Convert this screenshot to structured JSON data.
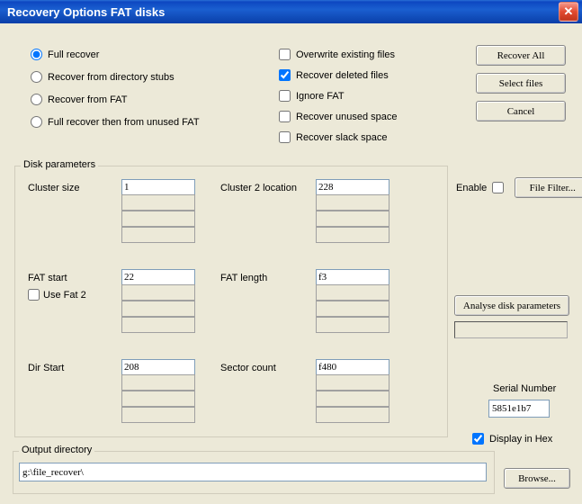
{
  "title": "Recovery Options FAT disks",
  "radios": {
    "full": "Full recover",
    "stubs": "Recover from directory stubs",
    "fat": "Recover from FAT",
    "then": "Full recover then from unused FAT"
  },
  "checks": {
    "overwrite": "Overwrite existing files",
    "deleted": "Recover deleted files",
    "ignore": "Ignore FAT",
    "unused": "Recover unused space",
    "slack": "Recover slack space"
  },
  "buttons": {
    "recover_all": "Recover All",
    "select_files": "Select files",
    "cancel": "Cancel",
    "file_filter": "File Filter...",
    "analyse": "Analyse disk parameters",
    "browse": "Browse..."
  },
  "disk_params": {
    "legend": "Disk parameters",
    "cluster_size": {
      "label": "Cluster size",
      "value": "1"
    },
    "cluster2_loc": {
      "label": "Cluster 2 location",
      "value": "228"
    },
    "fat_start": {
      "label": "FAT start",
      "value": "22"
    },
    "fat_length": {
      "label": "FAT length",
      "value": "f3"
    },
    "use_fat2": "Use Fat 2",
    "dir_start": {
      "label": "Dir Start",
      "value": "208"
    },
    "sector_count": {
      "label": "Sector count",
      "value": "f480"
    }
  },
  "enable_label": "Enable",
  "serial": {
    "label": "Serial Number",
    "value": "5851e1b7"
  },
  "display_hex": "Display in Hex",
  "output": {
    "legend": "Output directory",
    "value": "g:\\file_recover\\"
  }
}
